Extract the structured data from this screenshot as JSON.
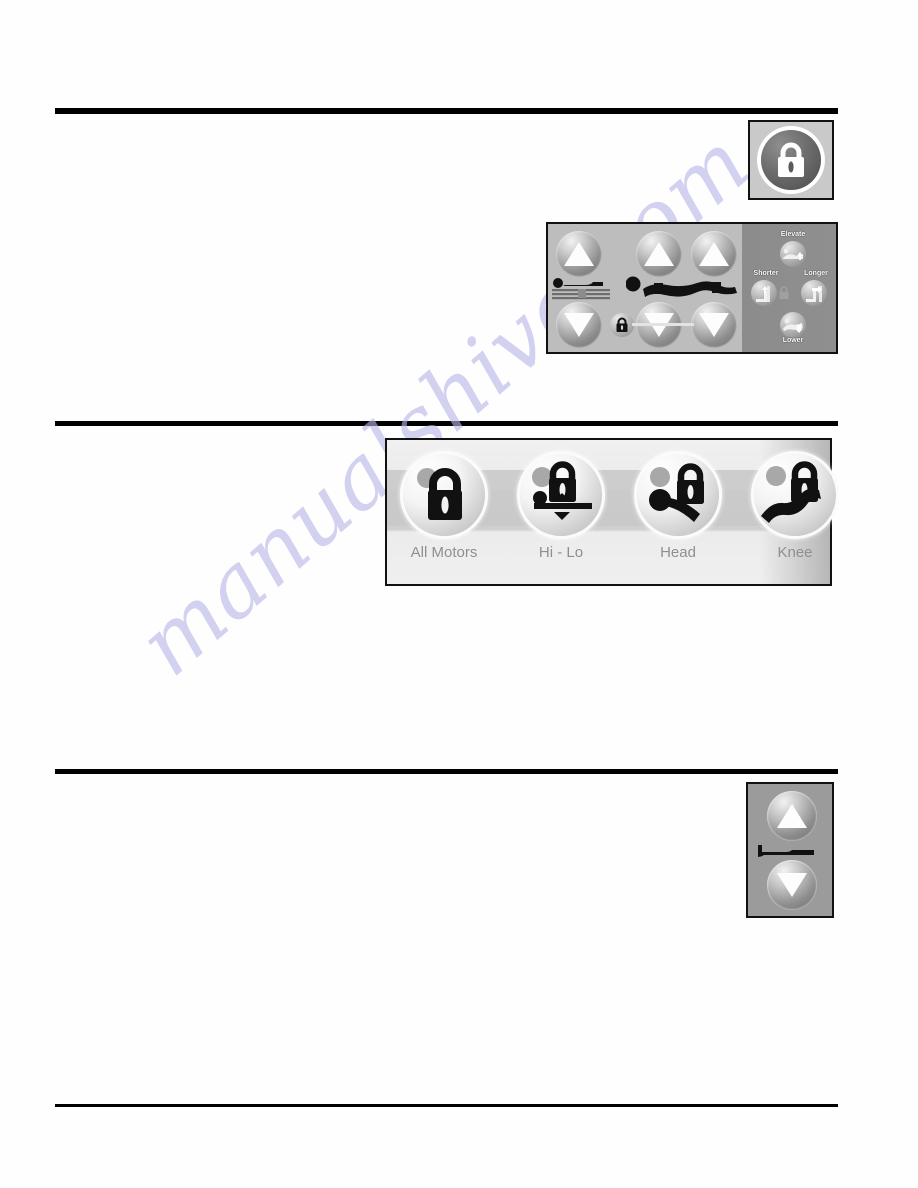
{
  "page": {
    "kind": "scanned-manual-page",
    "watermark": "manualshive.com",
    "background_color": "#ffffff",
    "rule_color": "#000000"
  },
  "rules": [
    {
      "name": "rule-1",
      "thickness_px": 6
    },
    {
      "name": "rule-2",
      "thickness_px": 5
    },
    {
      "name": "rule-3",
      "thickness_px": 5
    },
    {
      "name": "rule-4",
      "thickness_px": 3
    }
  ],
  "figures": {
    "lock_indicator": {
      "caption": "",
      "icon": "padlock-icon",
      "panel_color": "#c9c9c9",
      "disc_color": "#6f6f6f"
    },
    "control_pad": {
      "panel_color": "#bdbdbd",
      "right_panel_color": "#8c8c8c",
      "buttons": [
        {
          "name": "bed-up-button",
          "icon": "triangle-up-icon"
        },
        {
          "name": "head-up-button",
          "icon": "triangle-up-icon"
        },
        {
          "name": "knee-up-button",
          "icon": "triangle-up-icon"
        },
        {
          "name": "bed-down-button",
          "icon": "triangle-down-icon"
        },
        {
          "name": "head-down-button",
          "icon": "triangle-down-icon"
        },
        {
          "name": "knee-down-button",
          "icon": "triangle-down-icon"
        }
      ],
      "right_labels": [
        {
          "name": "elevate-label",
          "text": "Elevate"
        },
        {
          "name": "shorter-label",
          "text": "Shorter"
        },
        {
          "name": "longer-label",
          "text": "Longer"
        },
        {
          "name": "lower-label",
          "text": "Lower"
        }
      ],
      "center_lock_icon": "padlock-icon"
    },
    "lockout_row": {
      "panel_color": "#eaeaea",
      "items": [
        {
          "name": "all-motors-lock",
          "label": "All Motors",
          "icon": "padlock-icon"
        },
        {
          "name": "hi-lo-lock",
          "label": "Hi - Lo",
          "icon": "padlock-updown-icon"
        },
        {
          "name": "head-lock",
          "label": "Head",
          "icon": "padlock-head-icon"
        },
        {
          "name": "knee-lock",
          "label": "Knee",
          "icon": "padlock-knee-icon"
        }
      ],
      "label_color": "#8f8f8f"
    },
    "updown_pad": {
      "panel_color": "#9b9b9b",
      "buttons": [
        {
          "name": "up-button",
          "icon": "triangle-up-icon"
        },
        {
          "name": "down-button",
          "icon": "triangle-down-icon"
        }
      ],
      "center_icon": "bed-side-icon"
    }
  }
}
